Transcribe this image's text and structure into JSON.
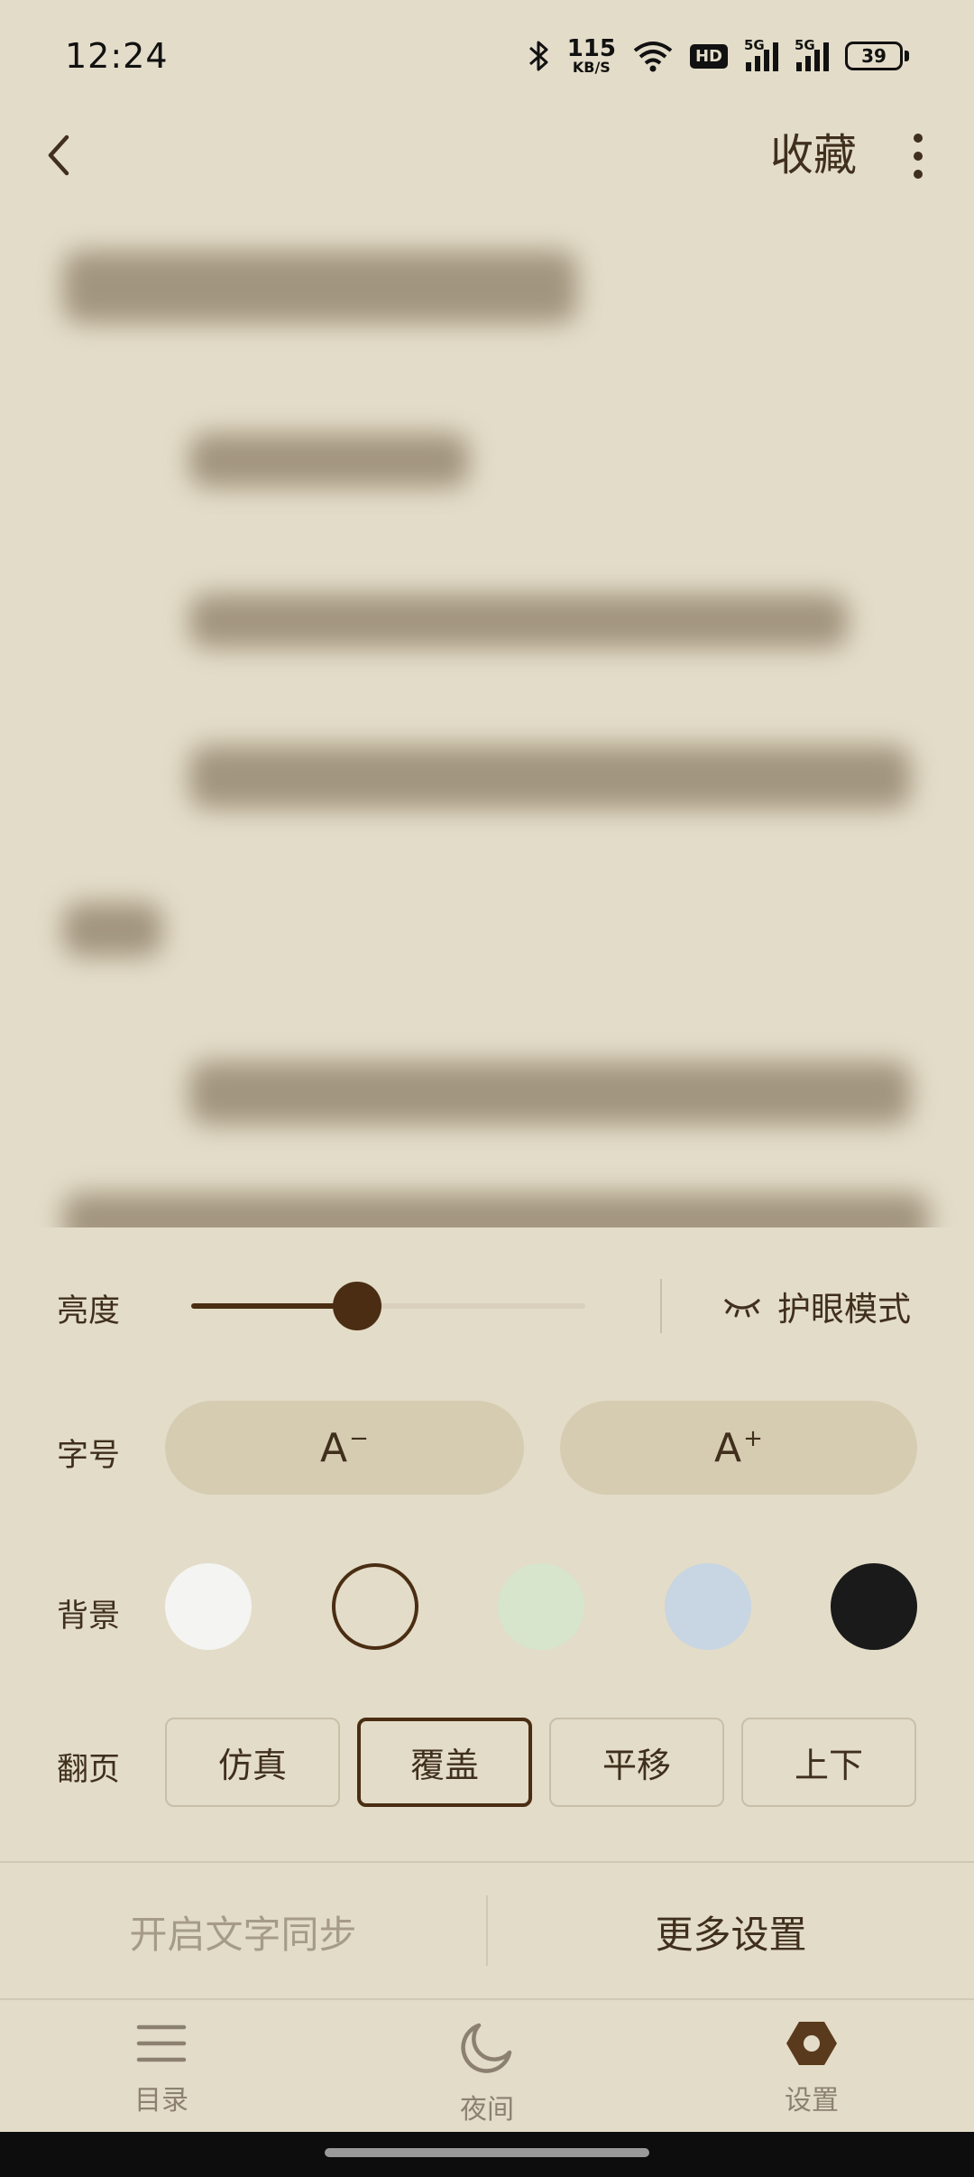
{
  "status": {
    "time": "12:24",
    "speed_value": "115",
    "speed_unit": "KB/S",
    "hd_label": "HD",
    "net1": "5G",
    "net2": "5G",
    "battery": "39"
  },
  "header": {
    "collect_label": "收藏"
  },
  "settings": {
    "brightness_label": "亮度",
    "brightness_level": 0.42,
    "eye_mode_label": "护眼模式",
    "font_label": "字号",
    "font_decrease": "A",
    "font_decrease_sign": "−",
    "font_increase": "A",
    "font_increase_sign": "+",
    "bg_label": "背景",
    "backgrounds": [
      "#f4f4f2",
      "#e3dcc8",
      "#d6e5cc",
      "#c8d5e2",
      "#1a1a1a"
    ],
    "flip_label": "翻页",
    "flip_modes": [
      "仿真",
      "覆盖",
      "平移",
      "上下"
    ],
    "flip_selected": 1
  },
  "actions": {
    "sync_text": "开启文字同步",
    "more_settings": "更多设置"
  },
  "tabs": {
    "catalog": "目录",
    "night": "夜间",
    "settings": "设置"
  },
  "colors": {
    "background": "#e3dcc8",
    "accent": "#4a2d12",
    "text": "#3f2f1c",
    "muted": "#8c8170"
  }
}
